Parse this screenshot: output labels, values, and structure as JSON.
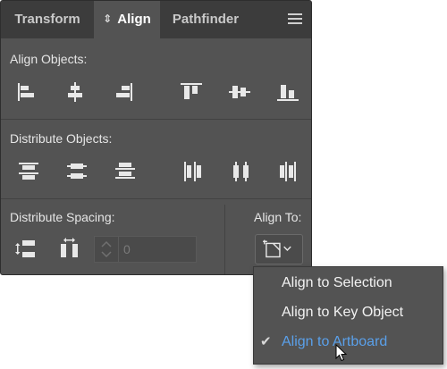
{
  "tabs": [
    {
      "label": "Transform",
      "active": false
    },
    {
      "label": "Align",
      "active": true
    },
    {
      "label": "Pathfinder",
      "active": false
    }
  ],
  "sections": {
    "align_objects": "Align Objects:",
    "distribute_objects": "Distribute Objects:",
    "distribute_spacing": "Distribute Spacing:",
    "align_to": "Align To:"
  },
  "spacing": {
    "value": "0"
  },
  "dropdown": {
    "items": [
      {
        "label": "Align to Selection",
        "selected": false
      },
      {
        "label": "Align to Key Object",
        "selected": false
      },
      {
        "label": "Align to Artboard",
        "selected": true
      }
    ]
  },
  "colors": {
    "panel_bg": "#535353",
    "tab_bar_bg": "#3c3c3c",
    "selected_text": "#5aa0ea",
    "icon": "#e8e8e8"
  }
}
